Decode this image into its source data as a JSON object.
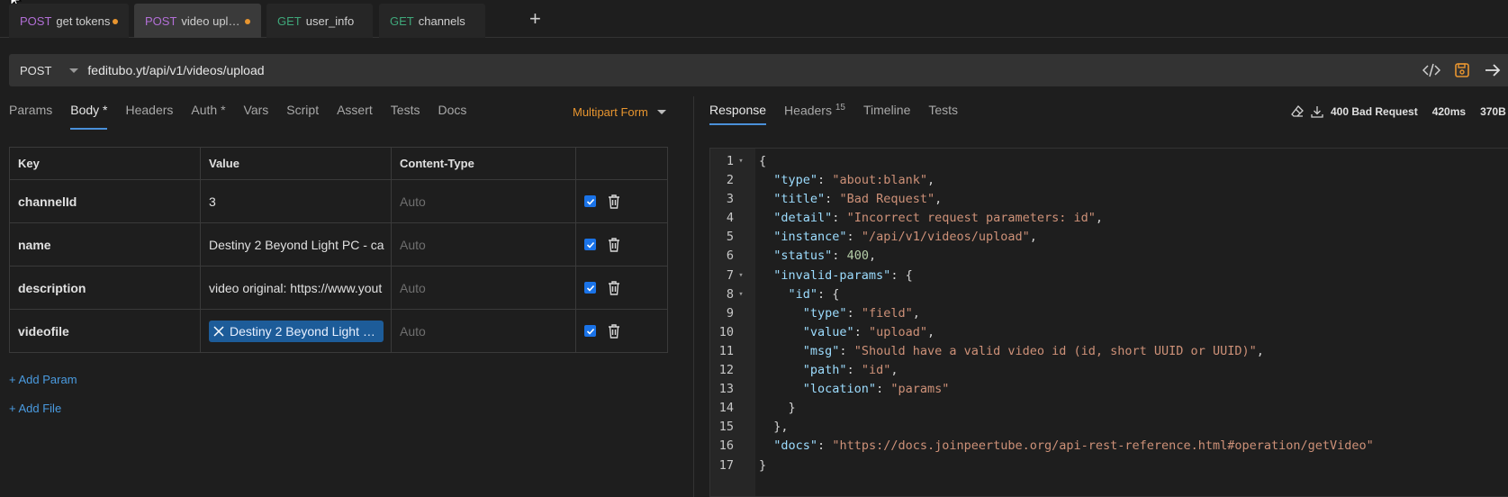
{
  "tabs": [
    {
      "method": "POST",
      "name": "get tokens",
      "unsaved": true
    },
    {
      "method": "POST",
      "name": "video upl…",
      "unsaved": true,
      "active": true
    },
    {
      "method": "GET",
      "name": "user_info"
    },
    {
      "method": "GET",
      "name": "channels"
    }
  ],
  "new_tab_label": "+",
  "request": {
    "method": "POST",
    "url": "feditubo.yt/api/v1/videos/upload"
  },
  "request_tabs": {
    "params": "Params",
    "body": "Body *",
    "headers": "Headers",
    "auth": "Auth *",
    "vars": "Vars",
    "script": "Script",
    "assert": "Assert",
    "tests": "Tests",
    "docs": "Docs"
  },
  "body_mode": "Multipart Form",
  "table": {
    "headers": {
      "key": "Key",
      "value": "Value",
      "content_type": "Content-Type"
    },
    "rows": [
      {
        "key": "channelId",
        "value": "3",
        "content_type": "Auto"
      },
      {
        "key": "name",
        "value": "Destiny 2 Beyond Light PC - ca",
        "content_type": "Auto"
      },
      {
        "key": "description",
        "value": "video original: https://www.yout",
        "content_type": "Auto"
      },
      {
        "key": "videofile",
        "value": "Destiny 2 Beyond Light …",
        "content_type": "Auto"
      }
    ]
  },
  "add_param": "+ Add Param",
  "add_file": "+ Add File",
  "response_tabs": {
    "response": "Response",
    "headers": "Headers",
    "headers_count": "15",
    "timeline": "Timeline",
    "tests": "Tests"
  },
  "response_status": {
    "status": "400 Bad Request",
    "time": "420ms",
    "size": "370B"
  },
  "response_lines": [
    "{",
    "  \"type\": \"about:blank\",",
    "  \"title\": \"Bad Request\",",
    "  \"detail\": \"Incorrect request parameters: id\",",
    "  \"instance\": \"/api/v1/videos/upload\",",
    "  \"status\": 400,",
    "  \"invalid-params\": {",
    "    \"id\": {",
    "      \"type\": \"field\",",
    "      \"value\": \"upload\",",
    "      \"msg\": \"Should have a valid video id (id, short UUID or UUID)\",",
    "      \"path\": \"id\",",
    "      \"location\": \"params\"",
    "    }",
    "  },",
    "  \"docs\": \"https://docs.joinpeertube.org/api-rest-reference.html#operation/getVideo\"",
    "}"
  ],
  "foldable_lines": [
    1,
    7,
    8
  ]
}
